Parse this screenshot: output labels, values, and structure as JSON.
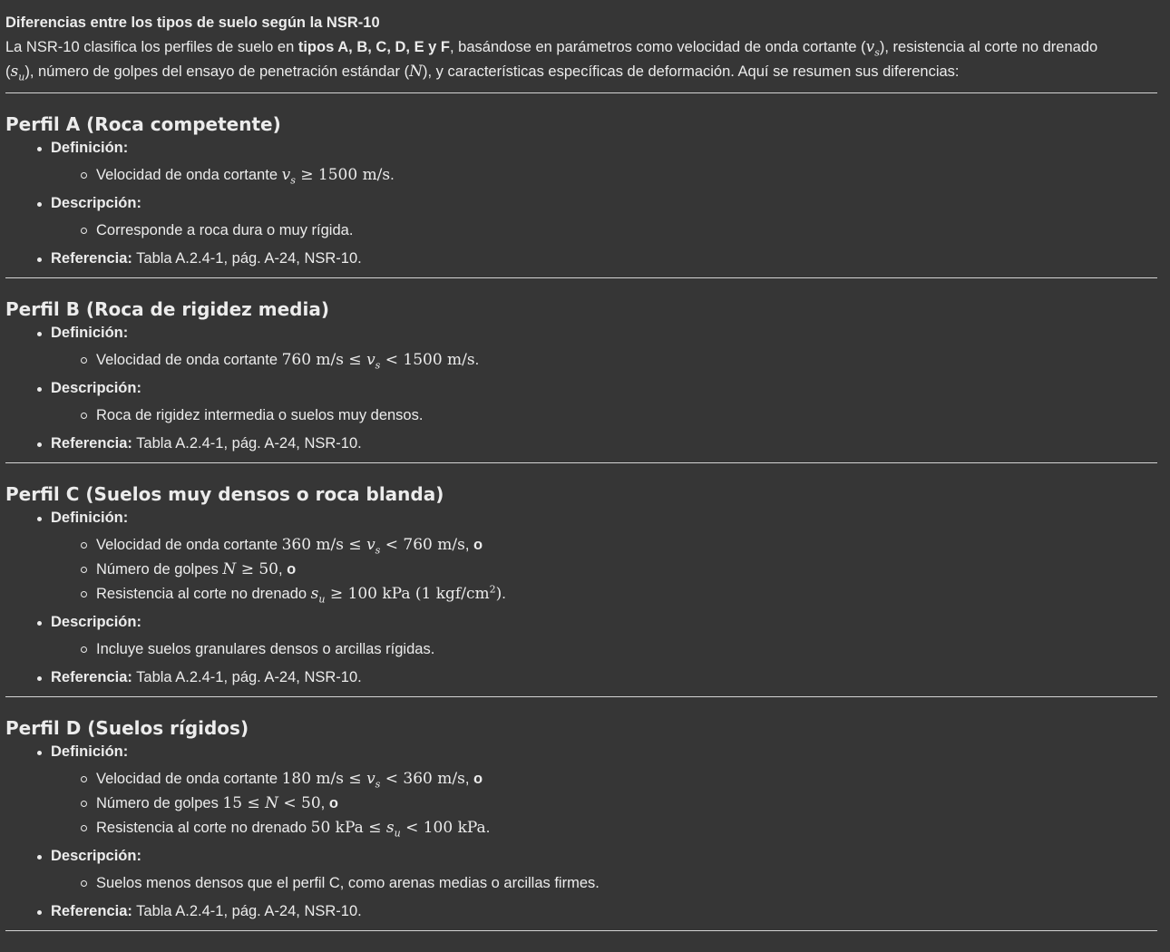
{
  "intro": {
    "title": "Diferencias entre los tipos de suelo según la NSR-10",
    "p1": "La NSR-10 clasifica los perfiles de suelo en ",
    "p1_bold": "tipos A, B, C, D, E y F",
    "p2": ", basándose en parámetros como velocidad de onda cortante (",
    "p3": "), resistencia al corte no drenado (",
    "p4": "), número de golpes del ensayo de penetración estándar (",
    "p5": "), y características específicas de deformación. Aquí se resumen sus diferencias:"
  },
  "labels": {
    "definicion": "Definición:",
    "descripcion": "Descripción:",
    "referencia": "Referencia:",
    "referencia_value": " Tabla A.2.4-1, pág. A-24, NSR-10."
  },
  "profiles": [
    {
      "title": "Perfil A (Roca competente)",
      "def": [
        "Velocidad de onda cortante "
      ],
      "desc": "Corresponde a roca dura o muy rígida."
    },
    {
      "title": "Perfil B (Roca de rigidez media)",
      "def": [
        "Velocidad de onda cortante "
      ],
      "desc": "Roca de rigidez intermedia o suelos muy densos."
    },
    {
      "title": "Perfil C (Suelos muy densos o roca blanda)",
      "def": [
        "Velocidad de onda cortante ",
        "Número de golpes ",
        "Resistencia al corte no drenado "
      ],
      "desc": "Incluye suelos granulares densos o arcillas rígidas."
    },
    {
      "title": "Perfil D (Suelos rígidos)",
      "def": [
        "Velocidad de onda cortante ",
        "Número de golpes ",
        "Resistencia al corte no drenado "
      ],
      "desc": "Suelos menos densos que el perfil C, como arenas medias o arcillas firmes."
    }
  ],
  "connector_o": "o"
}
